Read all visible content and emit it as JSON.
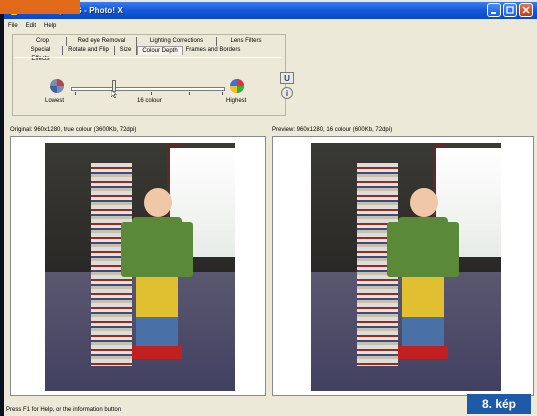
{
  "window": {
    "title": "9HBtorony.JPG - Photo! X",
    "controls": [
      "minimize",
      "maximize",
      "close"
    ]
  },
  "menu": [
    {
      "label": "File"
    },
    {
      "label": "Edit"
    },
    {
      "label": "Help"
    }
  ],
  "tabs": {
    "row1": [
      "Crop",
      "Red eye Removal",
      "Lighting Corrections",
      "Lens Filters"
    ],
    "row2": [
      "Special Effects",
      "Rotate and Flip",
      "Size",
      "Colour Depth",
      "Frames and Borders"
    ],
    "active": "Colour Depth"
  },
  "colour_depth": {
    "min_label": "Lowest",
    "max_label": "Highest",
    "current_label": "16 colour",
    "slider_fraction": 0.28
  },
  "side_buttons": [
    {
      "glyph": "U",
      "icon": "undo-icon"
    },
    {
      "glyph": "i",
      "icon": "info-icon"
    }
  ],
  "original": {
    "label": "Original: 960x1280, true colour (3600Kb, 72dpi)"
  },
  "preview": {
    "label": "Preview: 960x1280, 16 colour (600Kb, 72dpi)"
  },
  "status": {
    "text": "Press F1 for Help, or the information button"
  },
  "badge": {
    "text": "8. kép"
  },
  "colors": {
    "titlebar": "#0a46c8",
    "badge": "#1f5aa8",
    "accent_orange": "#e06a1a"
  }
}
